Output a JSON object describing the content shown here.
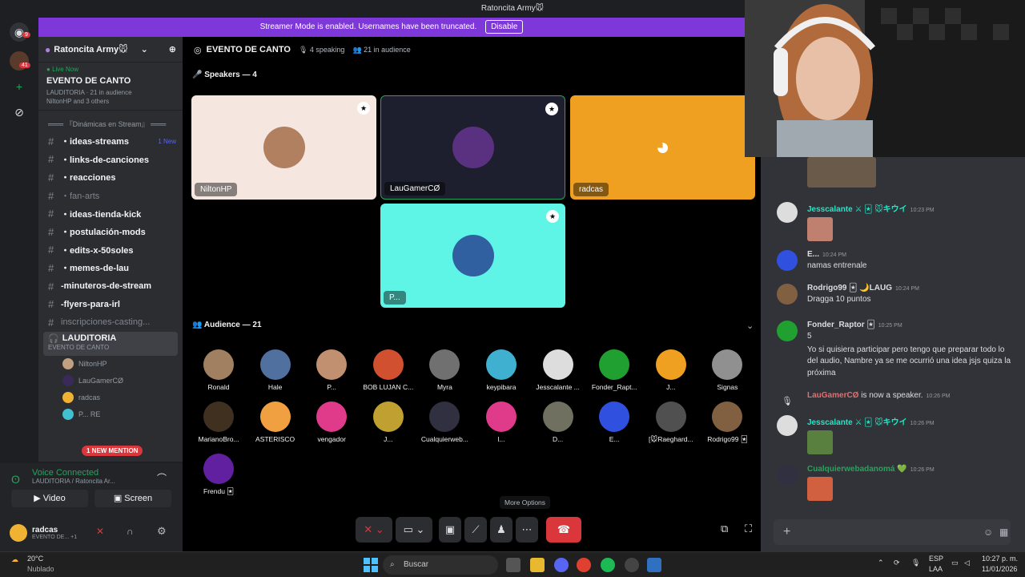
{
  "window_title": "Ratoncita Army🐭",
  "banner": {
    "text": "Streamer Mode is enabled. Usernames have been truncated.",
    "button": "Disable"
  },
  "rail": {
    "badge_top": "9",
    "badge_server": "41"
  },
  "server": {
    "name": "Ratoncita Army🐭"
  },
  "live": {
    "status": "Live Now",
    "title": "EVENTO DE CANTO",
    "room_line": "LAUDITORIA · 21 in audience",
    "people_line": "NiltonHP and 3 others"
  },
  "category": "═══ 『Dinámicas en Stream』 ═══",
  "channels": [
    {
      "name": "・ideas-streams",
      "badge": "1 New",
      "dim": false
    },
    {
      "name": "・links-de-canciones",
      "badge": "",
      "dim": false
    },
    {
      "name": "・reacciones",
      "badge": "",
      "dim": false
    },
    {
      "name": "・fan-arts",
      "badge": "",
      "dim": true
    },
    {
      "name": "・ideas-tienda-kick",
      "badge": "",
      "dim": false
    },
    {
      "name": "・postulación-mods",
      "badge": "",
      "dim": false
    },
    {
      "name": "・edits-x-50soles",
      "badge": "",
      "dim": false
    },
    {
      "name": "・memes-de-lau",
      "badge": "",
      "dim": false
    },
    {
      "name": "-minuteros-de-stream",
      "badge": "",
      "dim": false
    },
    {
      "name": "-flyers-para-irl",
      "badge": "",
      "dim": false
    },
    {
      "name": "inscripciones-casting...",
      "badge": "",
      "dim": true
    }
  ],
  "voice_channel": {
    "name": "LAUDITORIA",
    "sub": "EVENTO DE CANTO"
  },
  "voice_users": [
    {
      "name": "NiltonHP",
      "color": "#c0a080"
    },
    {
      "name": "LauGamerCØ",
      "color": "#3a2a5a"
    },
    {
      "name": "radcas",
      "color": "#f0b232"
    },
    {
      "name": "P... RE",
      "color": "#40c0d0"
    }
  ],
  "mention": "1 NEW MENTION",
  "voice_panel": {
    "status": "Voice Connected",
    "sub": "LAUDITORIA / Ratoncita Ar...",
    "video": "Video",
    "screen": "Screen"
  },
  "user": {
    "name": "radcas",
    "status": "EVENTO DE... +1"
  },
  "stage": {
    "title": "EVENTO DE CANTO",
    "speaking": "4 speaking",
    "audience_count": "21 in audience",
    "speakers_label": "Speakers — 4",
    "audience_label": "Audience — 21"
  },
  "speakers": [
    {
      "name": "NiltonHP",
      "bg": "#f5e6e0",
      "av": "#b08060"
    },
    {
      "name": "LauGamerCØ",
      "bg": "#1e1f2e",
      "av": "#5a3080"
    },
    {
      "name": "radcas",
      "bg": "#f0a020",
      "av": "#f0a020"
    },
    {
      "name": "P...",
      "bg": "#5ff5e6",
      "av": "#3060a0"
    }
  ],
  "audience": [
    {
      "name": "Ronald",
      "color": "#a08060"
    },
    {
      "name": "Hale",
      "color": "#5070a0"
    },
    {
      "name": "P...",
      "color": "#c09070"
    },
    {
      "name": "BOB LUJAN C...",
      "color": "#d05030"
    },
    {
      "name": "Myra",
      "color": "#707070"
    },
    {
      "name": "keypibara",
      "color": "#40b0d0"
    },
    {
      "name": "Jesscalante ...",
      "color": "#dddddd"
    },
    {
      "name": "Fonder_Rapt...",
      "color": "#20a030"
    },
    {
      "name": "J...",
      "color": "#f0a020"
    },
    {
      "name": "Signas",
      "color": "#909090"
    },
    {
      "name": "MarianoBro...",
      "color": "#403020"
    },
    {
      "name": "ASTERISCO",
      "color": "#f0a040"
    },
    {
      "name": "vengador",
      "color": "#e03a8a"
    },
    {
      "name": "J...",
      "color": "#c0a030"
    },
    {
      "name": "Cualquierweb...",
      "color": "#303040"
    },
    {
      "name": "l...",
      "color": "#e03a8a"
    },
    {
      "name": "D...",
      "color": "#707060"
    },
    {
      "name": "E...",
      "color": "#3050e0"
    },
    {
      "name": "[🐭Raeghard...",
      "color": "#505050"
    },
    {
      "name": "Rodrigo99 🃏",
      "color": "#806040"
    },
    {
      "name": "Frendu 🃏",
      "color": "#6020a0"
    }
  ],
  "tooltip": "More Options",
  "chat": [
    {
      "who": "Jesscalante ⚔ 🃏 🐭キウイ",
      "time": "10:23 PM",
      "text": "",
      "color": "#1ee8c8",
      "av": "#dddddd",
      "thumb": "#c08070"
    },
    {
      "who": "E...",
      "time": "10:24 PM",
      "text": "namas entrenale",
      "color": "#dbdee1",
      "av": "#3050e0",
      "thumb": ""
    },
    {
      "who": "Rodrigo99 🃏 🌙LAUG",
      "time": "10:24 PM",
      "text": "Dragga 10 puntos",
      "color": "#dbdee1",
      "av": "#806040",
      "thumb": ""
    },
    {
      "who": "Fonder_Raptor 🃏",
      "time": "10:25 PM",
      "text": "5\nYo si quisiera participar pero tengo que preparar todo lo del audio, Nambre ya se me ocurrió una idea jsjs quiza la próxima",
      "color": "#dbdee1",
      "av": "#20a030",
      "thumb": ""
    },
    {
      "who": "LauGamerCØ",
      "time": "10:26 PM",
      "text": " is now a speaker.",
      "color": "#e07070",
      "av": "",
      "thumb": ""
    },
    {
      "who": "Jesscalante ⚔ 🃏 🐭キウイ",
      "time": "10:26 PM",
      "text": "",
      "color": "#1ee8c8",
      "av": "#dddddd",
      "thumb": "#5a8040"
    },
    {
      "who": "Cualquierwebadanomá 💚",
      "time": "10:26 PM",
      "text": "",
      "color": "#23a55a",
      "av": "#303040",
      "thumb": "#d06040"
    }
  ],
  "taskbar": {
    "temp": "20°C",
    "weather": "Nublado",
    "search": "Buscar",
    "lang": "ESP",
    "lang2": "LAA",
    "time": "10:27 p. m.",
    "date": "11/01/2026"
  }
}
